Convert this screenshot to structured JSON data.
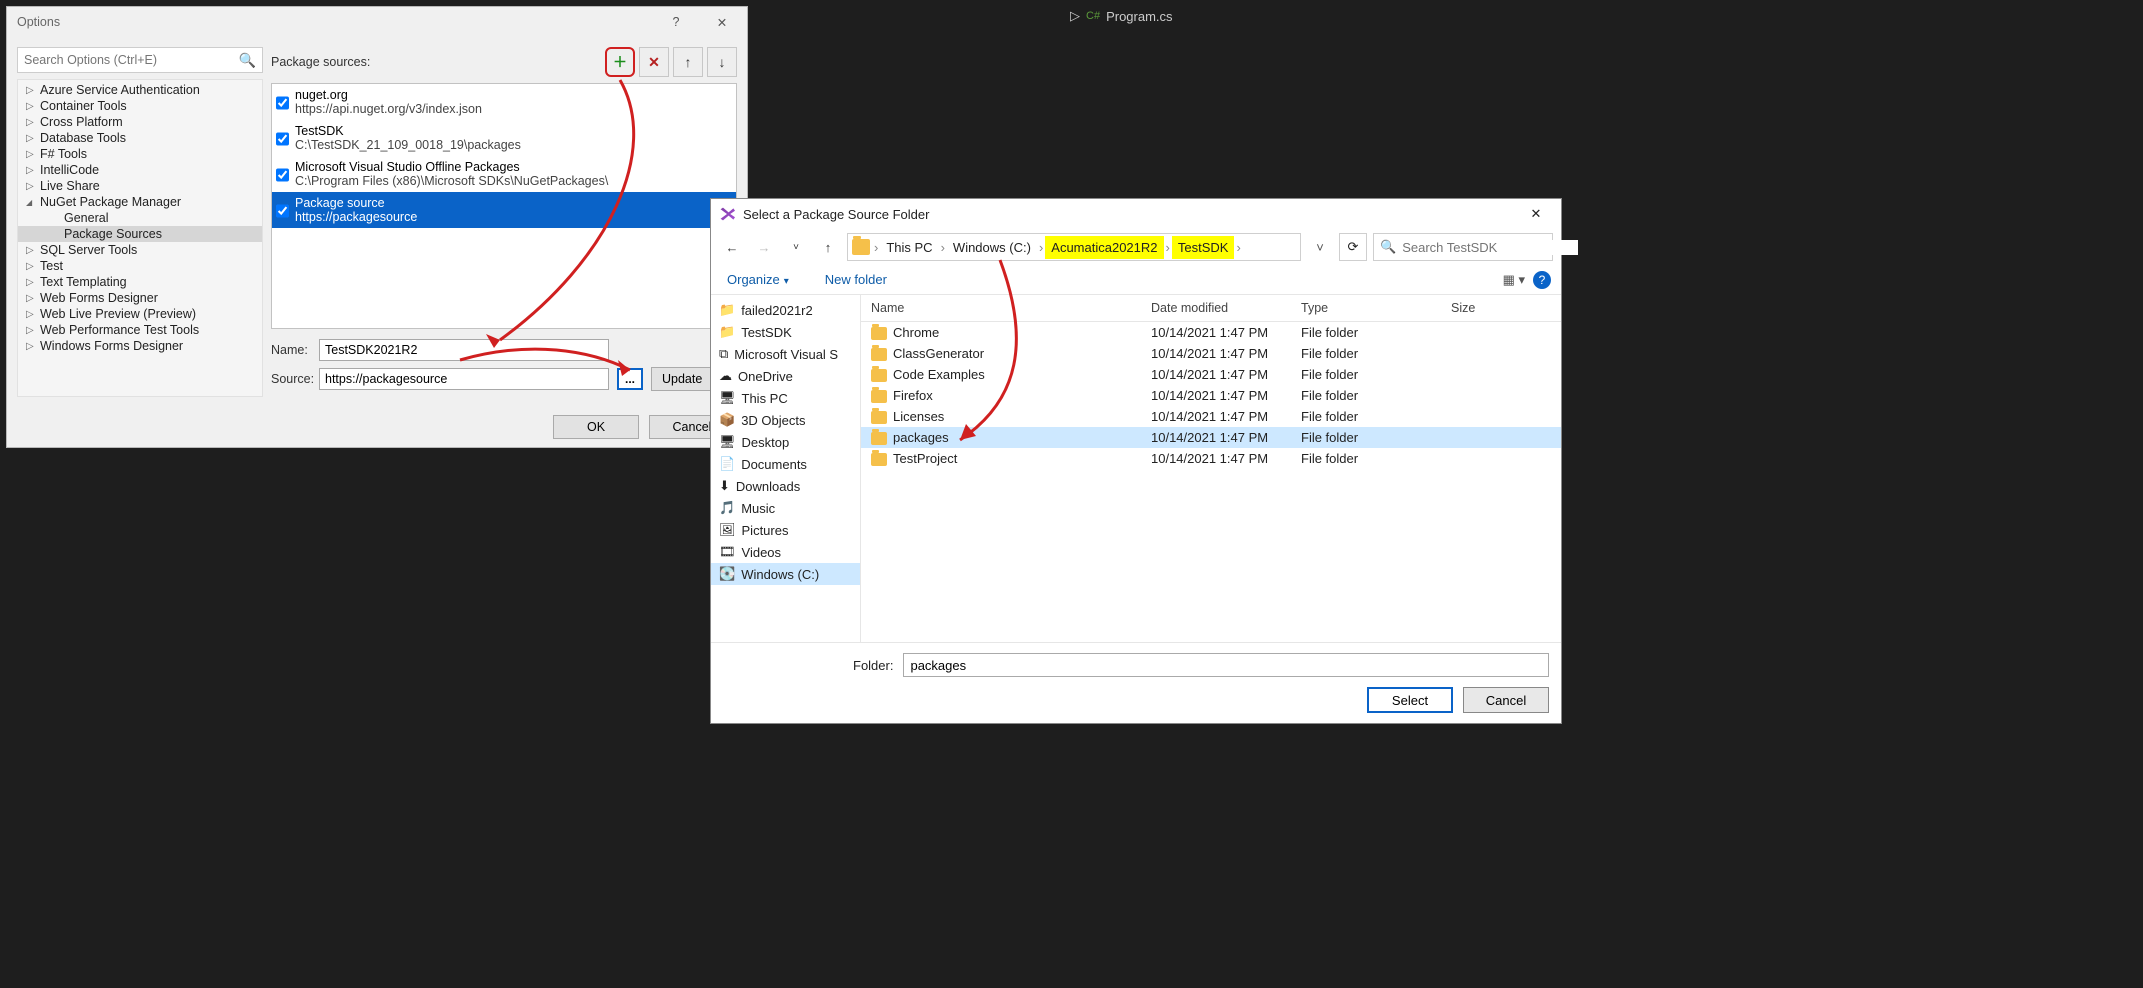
{
  "editor_tab": {
    "filename": "Program.cs",
    "lang_glyph": "C#"
  },
  "options": {
    "title": "Options",
    "search_placeholder": "Search Options (Ctrl+E)",
    "tree": [
      {
        "label": "Azure Service Authentication",
        "expanded": false,
        "children": []
      },
      {
        "label": "Container Tools",
        "expanded": false,
        "children": []
      },
      {
        "label": "Cross Platform",
        "expanded": false,
        "children": []
      },
      {
        "label": "Database Tools",
        "expanded": false,
        "children": []
      },
      {
        "label": "F# Tools",
        "expanded": false,
        "children": []
      },
      {
        "label": "IntelliCode",
        "expanded": false,
        "children": []
      },
      {
        "label": "Live Share",
        "expanded": false,
        "children": []
      },
      {
        "label": "NuGet Package Manager",
        "expanded": true,
        "children": [
          {
            "label": "General",
            "selected": false
          },
          {
            "label": "Package Sources",
            "selected": true
          }
        ]
      },
      {
        "label": "SQL Server Tools",
        "expanded": false,
        "children": []
      },
      {
        "label": "Test",
        "expanded": false,
        "children": []
      },
      {
        "label": "Text Templating",
        "expanded": false,
        "children": []
      },
      {
        "label": "Web Forms Designer",
        "expanded": false,
        "children": []
      },
      {
        "label": "Web Live Preview (Preview)",
        "expanded": false,
        "children": []
      },
      {
        "label": "Web Performance Test Tools",
        "expanded": false,
        "children": []
      },
      {
        "label": "Windows Forms Designer",
        "expanded": false,
        "children": []
      }
    ],
    "sources_label": "Package sources:",
    "source_rows": [
      {
        "checked": true,
        "name": "nuget.org",
        "path": "https://api.nuget.org/v3/index.json",
        "selected": false
      },
      {
        "checked": true,
        "name": "TestSDK",
        "path": "C:\\TestSDK_21_109_0018_19\\packages",
        "selected": false
      },
      {
        "checked": true,
        "name": "Microsoft Visual Studio Offline Packages",
        "path": "C:\\Program Files (x86)\\Microsoft SDKs\\NuGetPackages\\",
        "selected": false
      },
      {
        "checked": true,
        "name": "Package source",
        "path": "https://packagesource",
        "selected": true
      }
    ],
    "name_label": "Name:",
    "name_value": "TestSDK2021R2",
    "source_label": "Source:",
    "source_value": "https://packagesource",
    "browse_label": "...",
    "update_label": "Update",
    "ok_label": "OK",
    "cancel_label": "Cancel"
  },
  "picker": {
    "title": "Select a Package Source Folder",
    "breadcrumb": [
      {
        "label": "This PC",
        "hl": false
      },
      {
        "label": "Windows (C:)",
        "hl": false
      },
      {
        "label": "Acumatica2021R2",
        "hl": true
      },
      {
        "label": "TestSDK",
        "hl": true
      }
    ],
    "search_placeholder": "Search TestSDK",
    "organize_label": "Organize",
    "newfolder_label": "New folder",
    "tree": [
      {
        "label": "failed2021r2",
        "icon": "folder"
      },
      {
        "label": "TestSDK",
        "icon": "folder"
      },
      {
        "label": "Microsoft Visual S",
        "icon": "vs"
      },
      {
        "label": "OneDrive",
        "icon": "onedrive"
      },
      {
        "label": "This PC",
        "icon": "pc"
      },
      {
        "label": "3D Objects",
        "icon": "3d"
      },
      {
        "label": "Desktop",
        "icon": "desktop"
      },
      {
        "label": "Documents",
        "icon": "docs"
      },
      {
        "label": "Downloads",
        "icon": "downloads"
      },
      {
        "label": "Music",
        "icon": "music"
      },
      {
        "label": "Pictures",
        "icon": "pictures"
      },
      {
        "label": "Videos",
        "icon": "videos"
      },
      {
        "label": "Windows (C:)",
        "icon": "drive",
        "selected": true
      }
    ],
    "cols": {
      "name": "Name",
      "date": "Date modified",
      "type": "Type",
      "size": "Size"
    },
    "rows": [
      {
        "name": "Chrome",
        "date": "10/14/2021 1:47 PM",
        "type": "File folder",
        "selected": false
      },
      {
        "name": "ClassGenerator",
        "date": "10/14/2021 1:47 PM",
        "type": "File folder",
        "selected": false
      },
      {
        "name": "Code Examples",
        "date": "10/14/2021 1:47 PM",
        "type": "File folder",
        "selected": false
      },
      {
        "name": "Firefox",
        "date": "10/14/2021 1:47 PM",
        "type": "File folder",
        "selected": false
      },
      {
        "name": "Licenses",
        "date": "10/14/2021 1:47 PM",
        "type": "File folder",
        "selected": false
      },
      {
        "name": "packages",
        "date": "10/14/2021 1:47 PM",
        "type": "File folder",
        "selected": true
      },
      {
        "name": "TestProject",
        "date": "10/14/2021 1:47 PM",
        "type": "File folder",
        "selected": false
      }
    ],
    "folder_label": "Folder:",
    "folder_value": "packages",
    "select_label": "Select",
    "cancel_label": "Cancel"
  }
}
